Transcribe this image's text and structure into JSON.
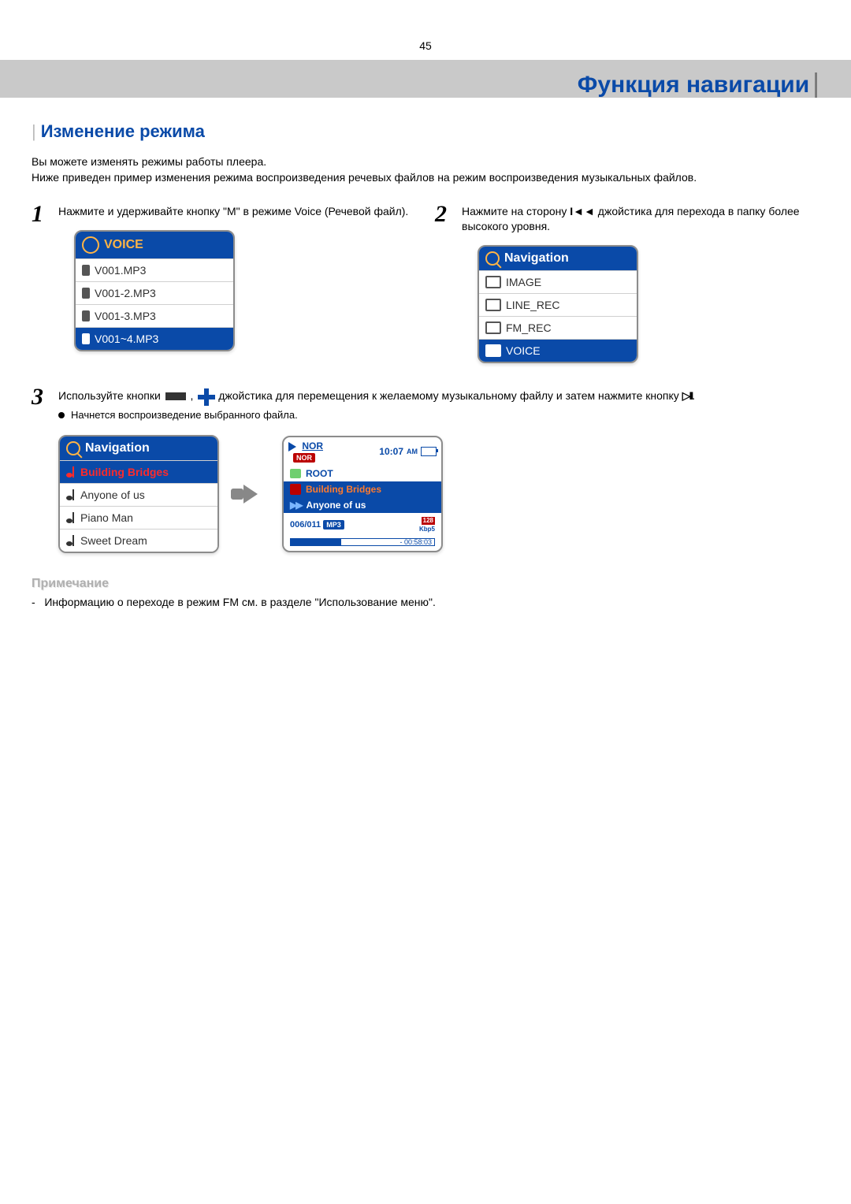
{
  "page_number": "45",
  "banner_title": "Функция навигации",
  "section_title": "Изменение режима",
  "intro_line1": "Вы можете изменять режимы работы плеера.",
  "intro_line2": "Ниже приведен пример изменения режима воспроизведения речевых файлов на режим воспроизведения музыкальных файлов.",
  "step1": {
    "num": "1",
    "text": "Нажмите и удерживайте кнопку \"M\"  в режиме Voice (Речевой файл)."
  },
  "step2": {
    "num": "2",
    "text_part1": "Нажмите на сторону ",
    "prev_symbol": "I◄◄",
    "text_part2": " джойстика для перехода в папку более высокого уровня."
  },
  "step3": {
    "num": "3",
    "text_part1": "Используйте кнопки ",
    "text_part2": " , ",
    "text_part3": " джойстика для перемещения к желаемому музыкальному файлу и затем нажмите кнопку ",
    "playpause": "▷II",
    "text_part4": ".",
    "bullet": "Начнется воспроизведение выбранного файла."
  },
  "screen_voice": {
    "header": "VOICE",
    "items": [
      "V001.MP3",
      "V001-2.MP3",
      "V001-3.MP3",
      "V001~4.MP3"
    ]
  },
  "screen_nav_folders": {
    "header": "Navigation",
    "items": [
      "IMAGE",
      "LINE_REC",
      "FM_REC",
      "VOICE"
    ]
  },
  "screen_nav_music": {
    "header": "Navigation",
    "items": [
      "Building Bridges",
      "Anyone of us",
      "Piano Man",
      "Sweet Dream"
    ]
  },
  "screen_nowplaying": {
    "nor": "NOR",
    "nor_badge": "NOR",
    "time": "10:07",
    "ampm": "AM",
    "root": "ROOT",
    "track1": "Building Bridges",
    "track2": "Anyone of us",
    "counter": "006/011",
    "codec": "MP3",
    "bitrate_top": "128",
    "bitrate_bot": "Kbp5",
    "remaining": "- 00:58:03"
  },
  "note_heading": "Примечание",
  "note_line": "Информацию о переходе в режим FM см. в разделе \"Использование меню\"."
}
